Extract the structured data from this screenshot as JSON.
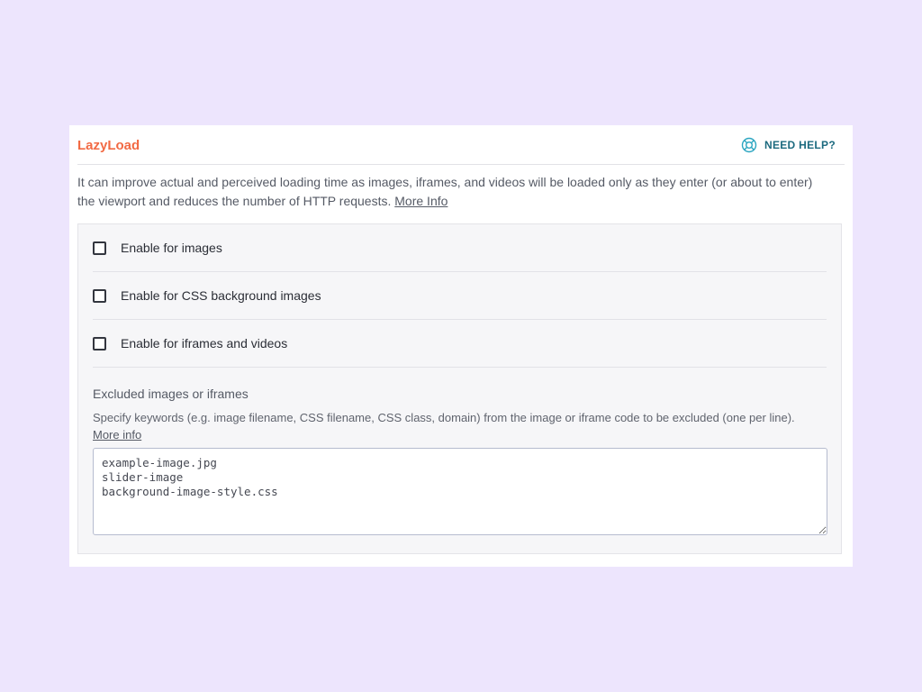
{
  "panel": {
    "title": "LazyLoad",
    "help_label": "NEED HELP?",
    "help_icon": "lifebuoy-icon",
    "intro_text": "It can improve actual and perceived loading time as images, iframes, and videos will be loaded only as they enter (or about to enter) the viewport and reduces the number of HTTP requests.",
    "intro_link": "More Info"
  },
  "options": [
    {
      "label": "Enable for images",
      "checked": false
    },
    {
      "label": "Enable for CSS background images",
      "checked": false
    },
    {
      "label": "Enable for iframes and videos",
      "checked": false
    }
  ],
  "exclusions": {
    "title": "Excluded images or iframes",
    "description": "Specify keywords (e.g. image filename, CSS filename, CSS class, domain) from the image or iframe code to be excluded (one per line).",
    "more_info_link": "More info",
    "value": "example-image.jpg\nslider-image\nbackground-image-style.css"
  },
  "colors": {
    "background": "#ede5fd",
    "title_accent": "#f26a44",
    "help_accent": "#1c6a7f"
  }
}
